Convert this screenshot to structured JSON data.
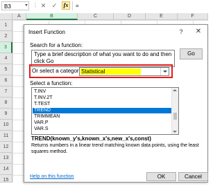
{
  "formula_bar": {
    "name_box": "B3",
    "cancel_symbol": "✕",
    "enter_symbol": "✓",
    "fx_label": "fx",
    "equals": "="
  },
  "grid": {
    "columns": [
      "A",
      "B",
      "C",
      "D",
      "E",
      "F"
    ],
    "rows": [
      "1",
      "2",
      "3",
      "4",
      "5",
      "6",
      "7",
      "8",
      "9",
      "10",
      "11",
      "12",
      "13",
      "14",
      "15"
    ],
    "selected_cell": "B3"
  },
  "dialog": {
    "title": "Insert Function",
    "help_symbol": "?",
    "close_symbol": "✕",
    "search_label": "Search for a function:",
    "search_text": "Type a brief description of what you want to do and then click Go",
    "go_label": "Go",
    "category_label": "Or select a category:",
    "category_value": "Statistical",
    "function_list_label": "Select a function:",
    "functions": [
      "T.INV",
      "T.INV.2T",
      "T.TEST",
      "TREND",
      "TRIMMEAN",
      "VAR.P",
      "VAR.S"
    ],
    "selected_function": "TREND",
    "syntax": "TREND(known_y's,known_x's,new_x's,const)",
    "description": "Returns numbers in a linear trend matching known data points, using the least squares method.",
    "help_link": "Help on this function",
    "ok_label": "OK",
    "cancel_label": "Cancel"
  },
  "colors": {
    "highlight": "#ffff00",
    "callout_border": "#e21b1b",
    "selection": "#0078d7",
    "excel_green": "#217346"
  }
}
